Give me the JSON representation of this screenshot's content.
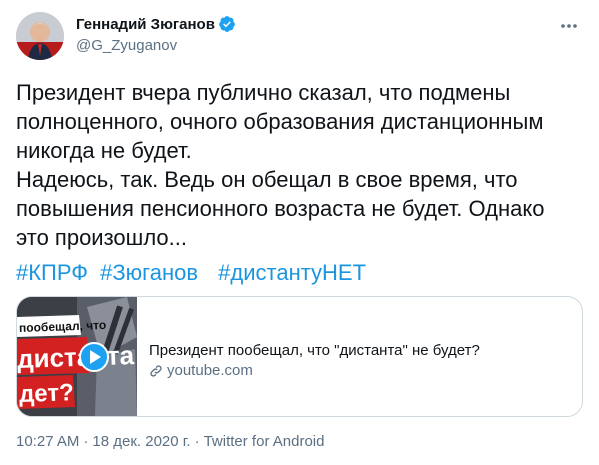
{
  "author": {
    "name": "Геннадий Зюганов",
    "handle": "@G_Zyuganov",
    "verified": true
  },
  "tweet": {
    "text": "Президент вчера публично сказал, что подмены\nполноценного, очного образования дистанционным\nникогда не будет.\nНадеюсь, так. Ведь он обещал в свое время, что\nповышения пенсионного возраста не будет. Однако\nэто произошло...",
    "hashtags": [
      "#КПРФ",
      "#Зюганов",
      "#дистантуНЕТ"
    ]
  },
  "card": {
    "title": "Президент пообещал, что \"дистанта\" не будет?",
    "domain": "youtube.com",
    "thumbnail_text": {
      "line1": "пообещал, что",
      "line2": "дистанта",
      "line3": "дет?"
    }
  },
  "meta": {
    "time": "10:27 AM",
    "date": "18 дек. 2020 г.",
    "source": "Twitter for Android",
    "separator": "·"
  },
  "colors": {
    "link": "#1b95e0",
    "secondary": "#5b7083",
    "verified": "#1da1f2",
    "border": "#cfd9de"
  },
  "icons": {
    "more": "more-icon",
    "verified": "verified-badge-icon",
    "play": "play-icon",
    "link": "link-icon"
  }
}
